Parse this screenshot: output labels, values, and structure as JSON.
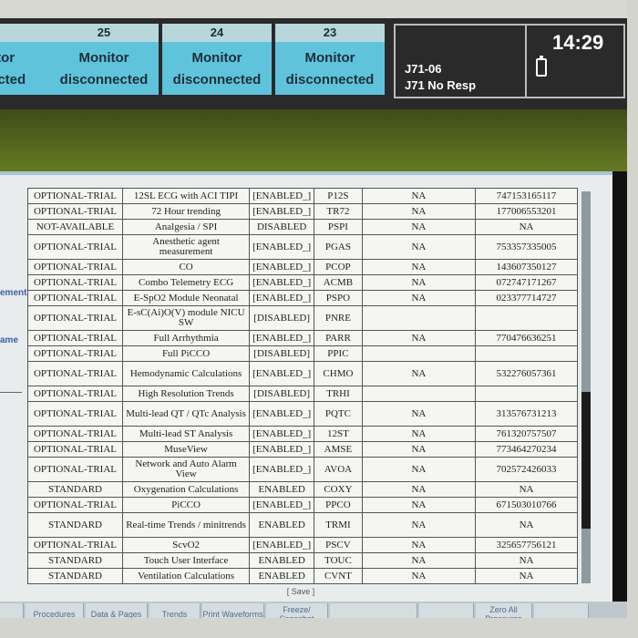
{
  "beds": [
    {
      "num": "",
      "line1": "itor",
      "line2": "nected"
    },
    {
      "num": "25",
      "line1": "Monitor",
      "line2": "disconnected"
    },
    {
      "num": "24",
      "line1": "Monitor",
      "line2": "disconnected"
    },
    {
      "num": "23",
      "line1": "Monitor",
      "line2": "disconnected"
    }
  ],
  "alarm": {
    "line1": "J71-06",
    "line2": "J71 No Resp",
    "time": "14:29"
  },
  "leftnav": {
    "item_a": "ement",
    "item_b": "ame"
  },
  "options": [
    [
      "OPTIONAL-TRIAL",
      "12SL ECG with ACI TIPI",
      "[ENABLED_]",
      "P12S",
      "NA",
      "747153165117"
    ],
    [
      "OPTIONAL-TRIAL",
      "72 Hour trending",
      "[ENABLED_]",
      "TR72",
      "NA",
      "177006553201"
    ],
    [
      "NOT-AVAILABLE",
      "Analgesia / SPI",
      "DISABLED",
      "PSPI",
      "NA",
      "NA"
    ],
    [
      "OPTIONAL-TRIAL",
      "Anesthetic agent measurement",
      "[ENABLED_]",
      "PGAS",
      "NA",
      "753357335005"
    ],
    [
      "OPTIONAL-TRIAL",
      "CO",
      "[ENABLED_]",
      "PCOP",
      "NA",
      "143607350127"
    ],
    [
      "OPTIONAL-TRIAL",
      "Combo Telemetry ECG",
      "[ENABLED_]",
      "ACMB",
      "NA",
      "072747171267"
    ],
    [
      "OPTIONAL-TRIAL",
      "E-SpO2 Module Neonatal",
      "[ENABLED_]",
      "PSPO",
      "NA",
      "023377714727"
    ],
    [
      "OPTIONAL-TRIAL",
      "E-sC(Ai)O(V) module NICU SW",
      "[DISABLED]",
      "PNRE",
      "",
      ""
    ],
    [
      "OPTIONAL-TRIAL",
      "Full Arrhythmia",
      "[ENABLED_]",
      "PARR",
      "NA",
      "770476636251"
    ],
    [
      "OPTIONAL-TRIAL",
      "Full PiCCO",
      "[DISABLED]",
      "PPIC",
      "",
      ""
    ],
    [
      "OPTIONAL-TRIAL",
      "Hemodynamic Calculations",
      "[ENABLED_]",
      "CHMO",
      "NA",
      "532276057361"
    ],
    [
      "OPTIONAL-TRIAL",
      "High Resolution Trends",
      "[DISABLED]",
      "TRHI",
      "",
      ""
    ],
    [
      "OPTIONAL-TRIAL",
      "Multi-lead QT / QTc Analysis",
      "[ENABLED_]",
      "PQTC",
      "NA",
      "313576731213"
    ],
    [
      "OPTIONAL-TRIAL",
      "Multi-lead ST Analysis",
      "[ENABLED_]",
      "12ST",
      "NA",
      "761320757507"
    ],
    [
      "OPTIONAL-TRIAL",
      "MuseView",
      "[ENABLED_]",
      "AMSE",
      "NA",
      "773464270234"
    ],
    [
      "OPTIONAL-TRIAL",
      "Network and Auto Alarm View",
      "[ENABLED_]",
      "AVOA",
      "NA",
      "702572426033"
    ],
    [
      "STANDARD",
      "Oxygenation Calculations",
      "ENABLED",
      "COXY",
      "NA",
      "NA"
    ],
    [
      "OPTIONAL-TRIAL",
      "PiCCO",
      "[ENABLED_]",
      "PPCO",
      "NA",
      "671503010766"
    ],
    [
      "STANDARD",
      "Real-time Trends / minitrends",
      "ENABLED",
      "TRMI",
      "NA",
      "NA"
    ],
    [
      "OPTIONAL-TRIAL",
      "ScvO2",
      "[ENABLED_]",
      "PSCV",
      "NA",
      "325657756121"
    ],
    [
      "STANDARD",
      "Touch User Interface",
      "ENABLED",
      "TOUC",
      "NA",
      "NA"
    ],
    [
      "STANDARD",
      "Ventilation Calculations",
      "ENABLED",
      "CVNT",
      "NA",
      "NA"
    ]
  ],
  "save_label": "[ Save ]",
  "softkeys": [
    "",
    "Procedures",
    "Data & Pages",
    "Trends",
    "Print Waveforms",
    "Freeze/ Snapshot",
    "",
    "",
    "Zero All Pressures",
    ""
  ]
}
